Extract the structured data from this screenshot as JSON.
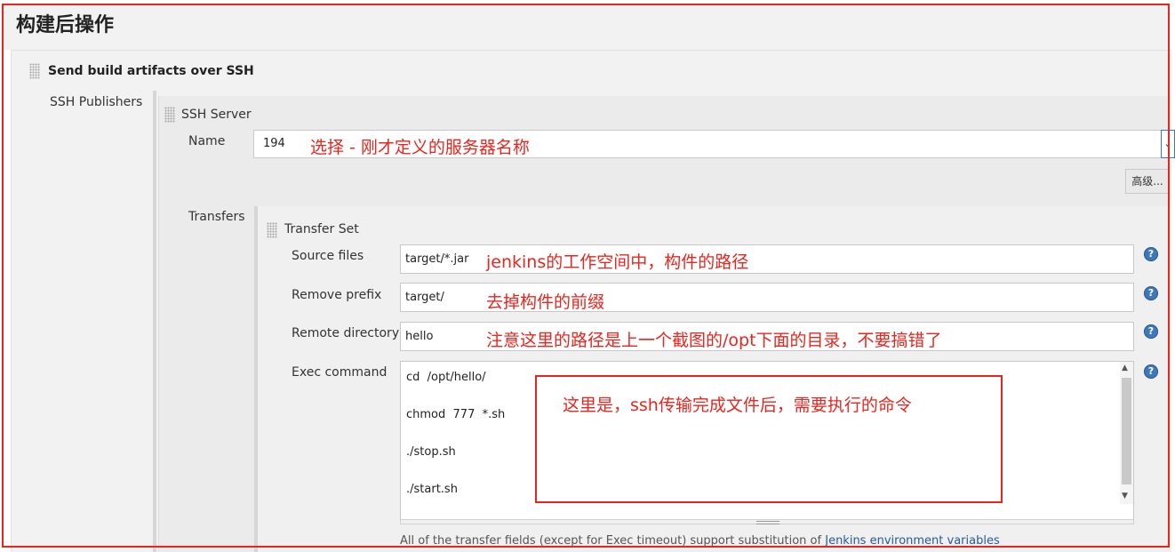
{
  "page": {
    "title": "构建后操作"
  },
  "step": {
    "title": "Send build artifacts over SSH"
  },
  "publishers": {
    "label": "SSH Publishers"
  },
  "server": {
    "title": "SSH Server",
    "name_label": "Name",
    "name_value": "194",
    "advanced_button": "高级..."
  },
  "transfers": {
    "label": "Transfers",
    "set_title": "Transfer Set",
    "source_files_label": "Source files",
    "source_files_value": "target/*.jar",
    "remove_prefix_label": "Remove prefix",
    "remove_prefix_value": "target/",
    "remote_directory_label": "Remote directory",
    "remote_directory_value": "hello",
    "exec_command_label": "Exec command",
    "exec_command_lines": [
      "cd  /opt/hello/",
      "chmod  777  *.sh",
      "./stop.sh",
      "./start.sh"
    ],
    "help_glyph": "?"
  },
  "footnote": {
    "text": "All of the transfer fields (except for Exec timeout) support substitution of ",
    "link": "Jenkins environment variables"
  },
  "annotations": {
    "name": "选择 - 刚才定义的服务器名称",
    "source": "jenkins的工作空间中，构件的路径",
    "prefix": "去掉构件的前缀",
    "remote": "注意这里的路径是上一个截图的/opt下面的目录，不要搞错了",
    "exec": "这里是，ssh传输完成文件后，需要执行的命令"
  },
  "colors": {
    "annotation": "#e8261f",
    "help_icon": "#3f78b8",
    "link": "#245aa0"
  }
}
